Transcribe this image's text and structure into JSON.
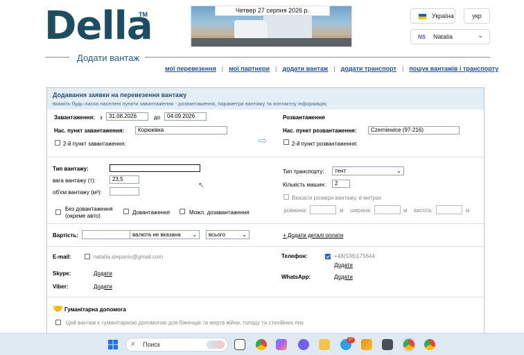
{
  "header": {
    "logo_text": "Della",
    "logo_mark": "TM",
    "banner_date": "Четвер 27 серпня 2026 р.",
    "lang_label": "Україна",
    "lang_code": "укр",
    "user_initials": "NS",
    "user_name": "Natalia",
    "page_title": "Додати вантаж"
  },
  "nav": [
    "мої перевезення",
    "мої партнери",
    "додати вантаж",
    "додати транспорт",
    "пошук вантажів і транспорту"
  ],
  "form": {
    "title": "Додавання заявки на перевезення вантажу",
    "subtitle": "вкажіть будь-ласка населені пункти завантаження - розвантаження, параметри вантажу та контактну інформацію",
    "loading": {
      "label": "Завантаження:",
      "from_prefix": "з",
      "from_date": "31.08.2026",
      "to_prefix": "до",
      "to_date": "04.09.2026",
      "place_label": "Нас. пункт завантаження:",
      "place_value": "Корюківка",
      "second_label": "2-й пункт завантаження:"
    },
    "unloading": {
      "label": "Розвантаження",
      "place_label": "Нас. пункт розвантаження:",
      "place_value": "Czerniewice (97-216)",
      "second_label": "2-й пункт розвантаження:"
    },
    "cargo": {
      "type_label": "Тип вантажу:",
      "type_value": "",
      "weight_label": "вага вантажу (т):",
      "weight_value": "23,5",
      "volume_label": "об'єм вантажу (м³):",
      "volume_value": "",
      "no_reload_label_1": "Без довантаження",
      "no_reload_label_2": "(окреме авто)",
      "reload_label": "Довантаження",
      "maybe_reload_label": "Можл. дозавантаження"
    },
    "transport": {
      "type_label": "Тип транспорту:",
      "type_value": "тент",
      "count_label": "Кількість машин:",
      "count_value": "2",
      "dims_label": "Вказати розміри вантажу, в метрах",
      "length_label": "довжина:",
      "width_label": "ширина:",
      "height_label": "висота:",
      "unit": "м"
    },
    "price": {
      "label": "Вартість:",
      "value": "",
      "currency": "валюта не вказана",
      "scope": "всього",
      "add_details": "+ Додати деталі оплати"
    },
    "contacts": {
      "email_label": "E-mail:",
      "email_value": "natalia.stepaniv@gmail.com",
      "skype_label": "Skype:",
      "skype_add": "Додати",
      "viber_label": "Viber:",
      "viber_add": "Додати",
      "phone_label": "Телефон:",
      "phone_value": "+48(536)175644",
      "phone_add": "Додати",
      "whatsapp_label": "WhatsApp:",
      "whatsapp_add": "Додати"
    },
    "humanitarian": {
      "title": "Гуманітарна допомога",
      "checkbox_label": "Цей вантаж є гуманітарною допомогою для біженців та жертв війни, голоду та стихійних лих"
    }
  },
  "taskbar": {
    "search_placeholder": "Поиск",
    "telegram_badge": "27"
  },
  "colors": {
    "link": "#1f4e9b",
    "logo": "#1d4d63",
    "form_header_bg": "#e3eef7",
    "checkbox_checked": "#1e66d8",
    "taskbar_bg": "#dfe9f2"
  }
}
